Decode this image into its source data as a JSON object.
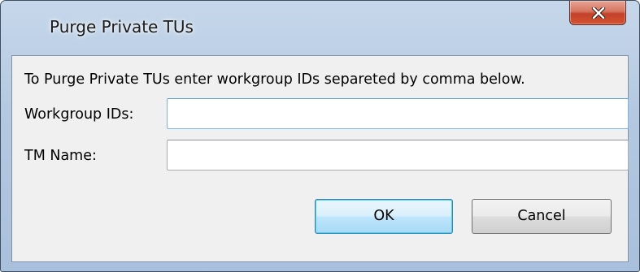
{
  "window": {
    "title": "Purge Private TUs"
  },
  "icons": {
    "close": "close-icon"
  },
  "colors": {
    "frame": "#b4c9e1",
    "close_button": "#c4412a",
    "client_background": "#f0f0f0",
    "default_button_border": "#3c7fb1"
  },
  "dialog": {
    "instruction": "To Purge Private TUs enter workgroup IDs separeted by comma below.",
    "workgroup_ids": {
      "label": "Workgroup IDs:",
      "value": ""
    },
    "tm_name": {
      "label": "TM Name:",
      "value": ""
    },
    "ok_label": "OK",
    "cancel_label": "Cancel"
  }
}
